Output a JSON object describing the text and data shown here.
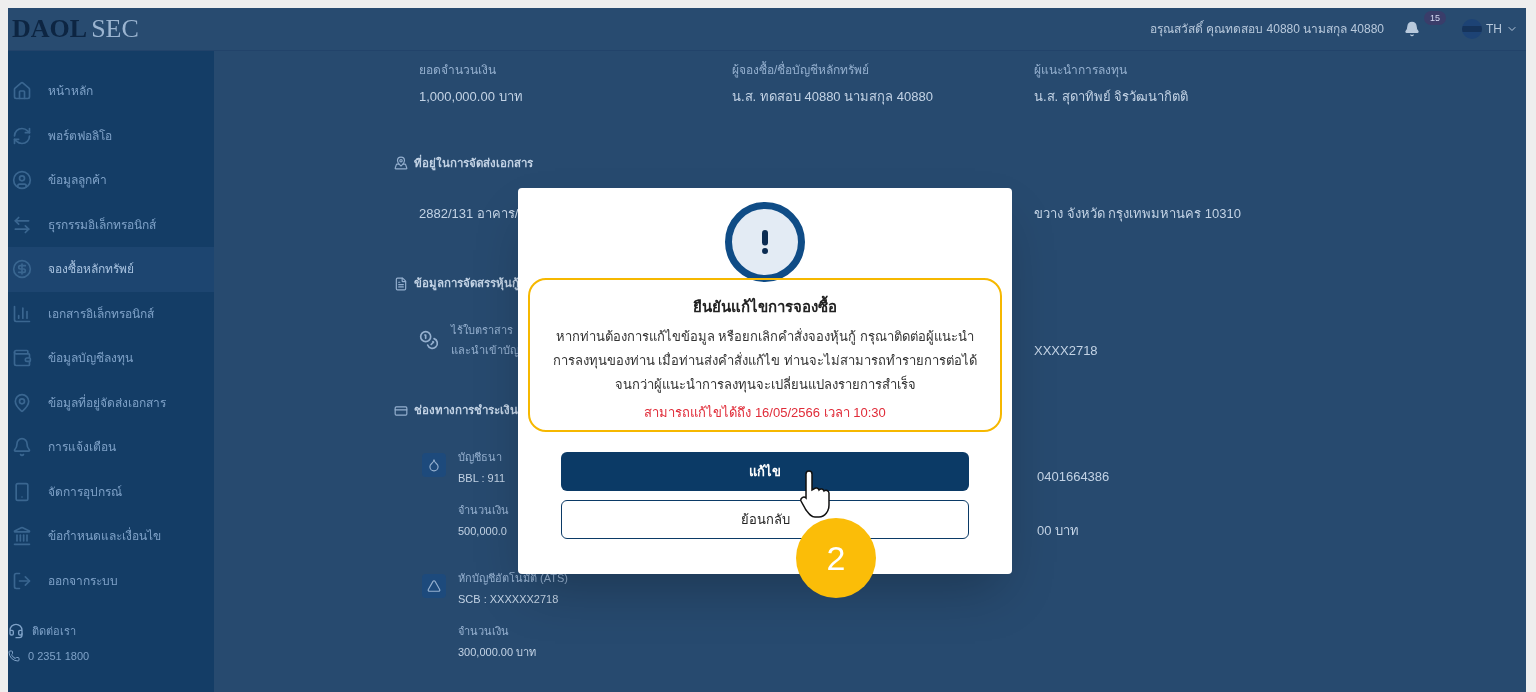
{
  "header": {
    "logo_bold": "DAOL",
    "logo_light": "SEC",
    "greeting": "อรุณสวัสดิ์ คุณทดสอบ 40880 นามสกุล 40880",
    "notification_count": "15",
    "language": "TH"
  },
  "sidebar": {
    "items": [
      {
        "label": "หน้าหลัก",
        "selected": false
      },
      {
        "label": "พอร์ตฟอลิโอ",
        "selected": false
      },
      {
        "label": "ข้อมูลลูกค้า",
        "selected": false
      },
      {
        "label": "ธุรกรรมอิเล็กทรอนิกส์",
        "selected": false
      },
      {
        "label": "จองซื้อหลักทรัพย์",
        "selected": true
      },
      {
        "label": "เอกสารอิเล็กทรอนิกส์",
        "selected": false
      },
      {
        "label": "ข้อมูลบัญชีลงทุน",
        "selected": false
      },
      {
        "label": "ข้อมูลที่อยู่จัดส่งเอกสาร",
        "selected": false
      },
      {
        "label": "การแจ้งเตือน",
        "selected": false
      },
      {
        "label": "จัดการอุปกรณ์",
        "selected": false
      },
      {
        "label": "ข้อกำหนดและเงื่อนไข",
        "selected": false
      },
      {
        "label": "ออกจากระบบ",
        "selected": false
      }
    ],
    "contact": {
      "title": "ติดต่อเรา",
      "phone": "0 2351 1800"
    }
  },
  "summary": [
    {
      "label": "ยอดจำนวนเงิน",
      "value": "1,000,000.00 บาท"
    },
    {
      "label": "ผู้จองซื้อ/ชื่อบัญชีหลักทรัพย์",
      "value": "น.ส. ทดสอบ 40880 นามสกุล 40880"
    },
    {
      "label": "ผู้แนะนำการลงทุน",
      "value": "น.ส. สุดาทิพย์ จิรวัฒนากิตติ"
    }
  ],
  "address_section": {
    "title": "ที่อยู่ในการจัดส่งเอกสาร",
    "text_left": "2882/131 อาคาร/",
    "text_right": "ขวาง จังหวัด กรุงเทพมหานคร 10310"
  },
  "allocation_section": {
    "title": "ข้อมูลการจัดสรรหุ้นกู้",
    "line_1": "ไร้ใบตราสาร",
    "line_2": "และนำเข้าบัญ",
    "right_value": "XXXX2718"
  },
  "payment_section": {
    "title": "ช่องทางการชำระเงิน",
    "methods": [
      {
        "label": "บัญชีธนา",
        "account": "BBL : 911",
        "amount_label": "จำนวนเงิน",
        "amount": "500,000.0",
        "right_account": "0401664386",
        "right_amount": "00 บาท"
      },
      {
        "label": "หักบัญชีอัตโนมัติ (ATS)",
        "account": "SCB : XXXXXX2718",
        "amount_label": "จำนวนเงิน",
        "amount": "300,000.00 บาท"
      }
    ]
  },
  "modal": {
    "title": "ยืนยันแก้ไขการจองซื้อ",
    "message": "หากท่านต้องการแก้ไขข้อมูล หรือยกเลิกคำสั่งจองหุ้นกู้ กรุณาติดต่อผู้แนะนำการลงทุนของท่าน เมื่อท่านส่งคำสั่งแก้ไข ท่านจะไม่สามารถทำรายการต่อได้ จนกว่าผู้แนะนำการลงทุนจะเปลี่ยนแปลงรายการสำเร็จ",
    "deadline": "สามารถแก้ไขได้ถึง 16/05/2566 เวลา 10:30",
    "buttons": [
      {
        "label": "แก้ไข",
        "kind": "primary"
      },
      {
        "label": "ย้อนกลับ",
        "kind": "secondary"
      }
    ]
  },
  "step_badge": "2"
}
